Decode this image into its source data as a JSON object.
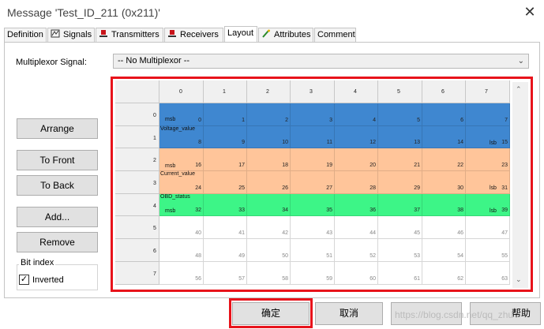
{
  "window": {
    "title": "Message 'Test_ID_211 (0x211)'",
    "close_label": "✕"
  },
  "tabs": [
    {
      "label": "Definition",
      "icon": ""
    },
    {
      "label": "Signals",
      "icon": "signal-icon"
    },
    {
      "label": "Transmitters",
      "icon": "transmitter-icon"
    },
    {
      "label": "Receivers",
      "icon": "receiver-icon"
    },
    {
      "label": "Layout",
      "icon": "",
      "active": true
    },
    {
      "label": "Attributes",
      "icon": "attributes-icon"
    },
    {
      "label": "Comment",
      "icon": ""
    }
  ],
  "multiplexor": {
    "label": "Multiplexor Signal:",
    "value": "-- No Multiplexor --"
  },
  "side_buttons": {
    "arrange": "Arrange",
    "to_front": "To Front",
    "to_back": "To Back",
    "add": "Add...",
    "remove": "Remove"
  },
  "bit_index": {
    "group_label": "Bit index",
    "inverted_label": "Inverted",
    "inverted_checked": true
  },
  "layout_grid": {
    "column_headers": [
      "0",
      "1",
      "2",
      "3",
      "4",
      "5",
      "6",
      "7"
    ],
    "row_headers": [
      "0",
      "1",
      "2",
      "3",
      "4",
      "5",
      "6",
      "7"
    ],
    "row_bits": [
      [
        "0",
        "1",
        "2",
        "3",
        "4",
        "5",
        "6",
        "7"
      ],
      [
        "8",
        "9",
        "10",
        "11",
        "12",
        "13",
        "14",
        "15"
      ],
      [
        "16",
        "17",
        "18",
        "19",
        "20",
        "21",
        "22",
        "23"
      ],
      [
        "24",
        "25",
        "26",
        "27",
        "28",
        "29",
        "30",
        "31"
      ],
      [
        "32",
        "33",
        "34",
        "35",
        "36",
        "37",
        "38",
        "39"
      ],
      [
        "40",
        "41",
        "42",
        "43",
        "44",
        "45",
        "46",
        "47"
      ],
      [
        "48",
        "49",
        "50",
        "51",
        "52",
        "53",
        "54",
        "55"
      ],
      [
        "56",
        "57",
        "58",
        "59",
        "60",
        "61",
        "62",
        "63"
      ]
    ],
    "signals": [
      {
        "name": "Voltage_value",
        "color": "#3f87d0",
        "msb": "msb",
        "lsb": "lsb"
      },
      {
        "name": "Current_value",
        "color": "#ffc59a",
        "msb": "msb",
        "lsb": "lsb"
      },
      {
        "name": "OBD_status",
        "color": "#3df587",
        "msb": "msb",
        "lsb": "lsb"
      }
    ]
  },
  "footer": {
    "ok": "确定",
    "cancel": "取消",
    "help": "帮助",
    "watermark": "https://blog.csdn.net/qq_zhu"
  },
  "colors": {
    "highlight_frame": "#e8131b"
  }
}
